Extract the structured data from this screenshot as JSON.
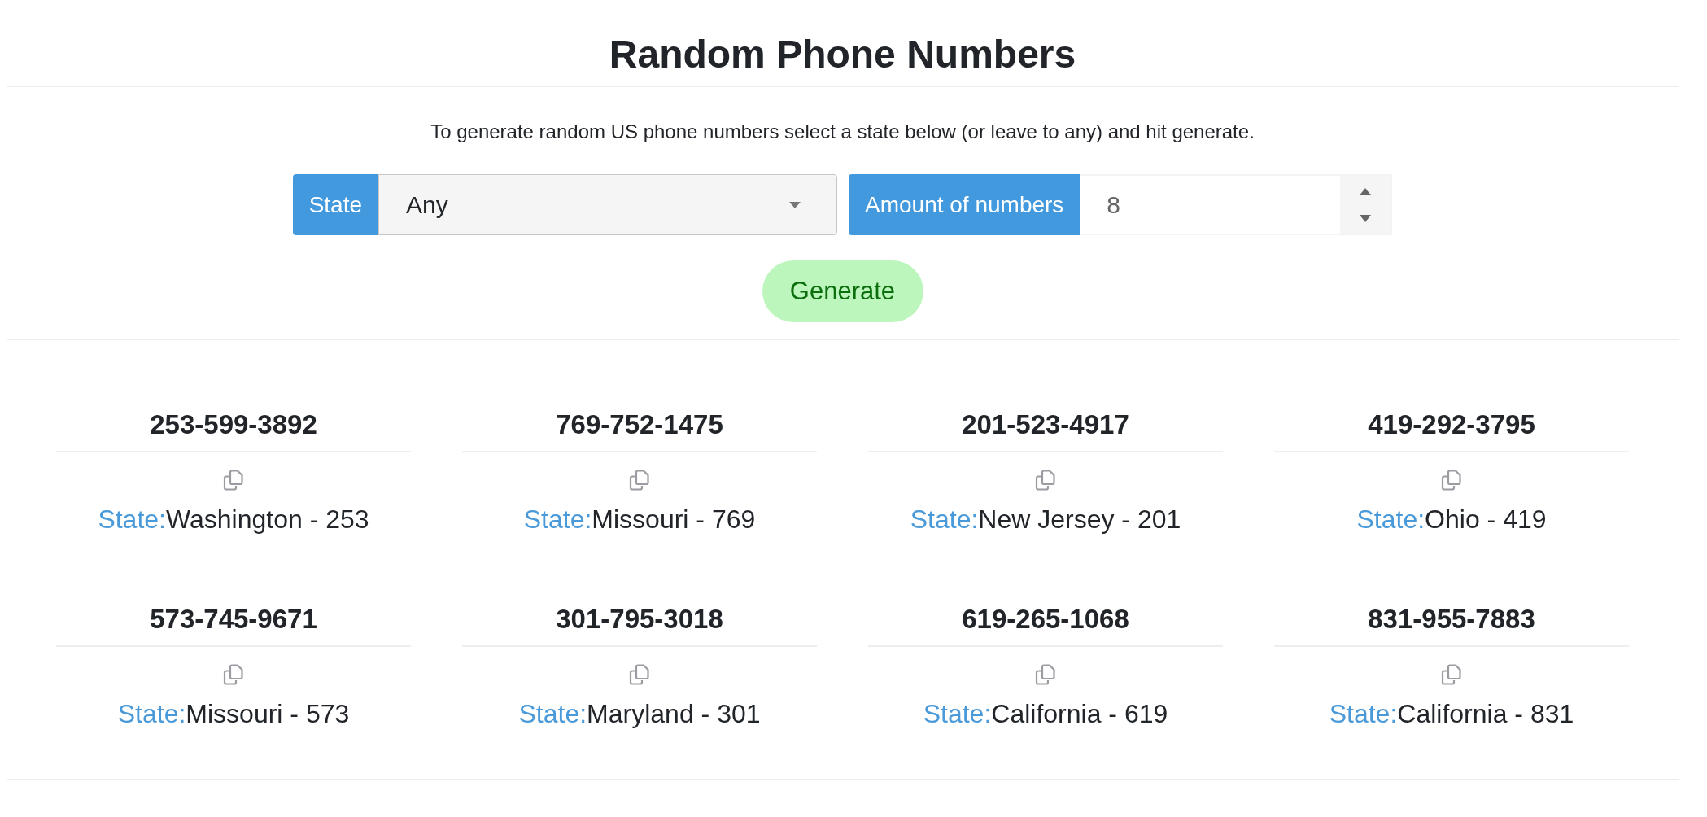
{
  "title": "Random Phone Numbers",
  "description": "To generate random US phone numbers select a state below (or leave to any) and hit generate.",
  "form": {
    "state_label": "State",
    "state_select": {
      "value": "Any"
    },
    "amount_label": "Amount of numbers",
    "amount_input": {
      "value": "8"
    },
    "generate_button": "Generate"
  },
  "results": [
    {
      "number": "253-599-3892",
      "state_label": "State:",
      "state": "Washington - 253"
    },
    {
      "number": "769-752-1475",
      "state_label": "State:",
      "state": "Missouri - 769"
    },
    {
      "number": "201-523-4917",
      "state_label": "State:",
      "state": "New Jersey - 201"
    },
    {
      "number": "419-292-3795",
      "state_label": "State:",
      "state": "Ohio - 419"
    },
    {
      "number": "573-745-9671",
      "state_label": "State:",
      "state": "Missouri - 573"
    },
    {
      "number": "301-795-3018",
      "state_label": "State:",
      "state": "Maryland - 301"
    },
    {
      "number": "619-265-1068",
      "state_label": "State:",
      "state": "California - 619"
    },
    {
      "number": "831-955-7883",
      "state_label": "State:",
      "state": "California - 831"
    }
  ]
}
